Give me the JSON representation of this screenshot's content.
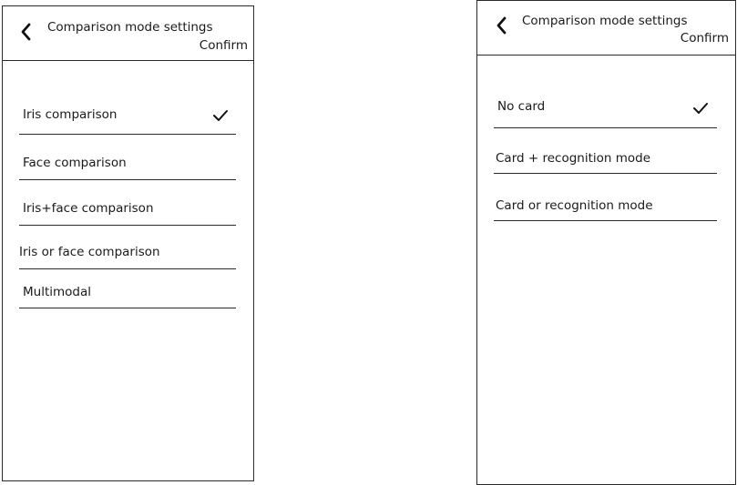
{
  "left": {
    "title": "Comparison mode settings",
    "confirm": "Confirm",
    "items": [
      {
        "label": "Iris comparison",
        "selected": true
      },
      {
        "label": "Face comparison",
        "selected": false
      },
      {
        "label": "Iris+face comparison",
        "selected": false
      },
      {
        "label": "Iris or face comparison",
        "selected": false
      },
      {
        "label": "Multimodal",
        "selected": false
      }
    ]
  },
  "right": {
    "title": "Comparison mode settings",
    "confirm": "Confirm",
    "items": [
      {
        "label": "No card",
        "selected": true
      },
      {
        "label": "Card + recognition mode",
        "selected": false
      },
      {
        "label": "Card or recognition mode",
        "selected": false
      }
    ]
  },
  "icons": {
    "back": "chevron-left-icon",
    "check": "checkmark-icon"
  },
  "colors": {
    "line": "#2a2a2a",
    "text": "#1a1a1a",
    "background": "#ffffff"
  }
}
